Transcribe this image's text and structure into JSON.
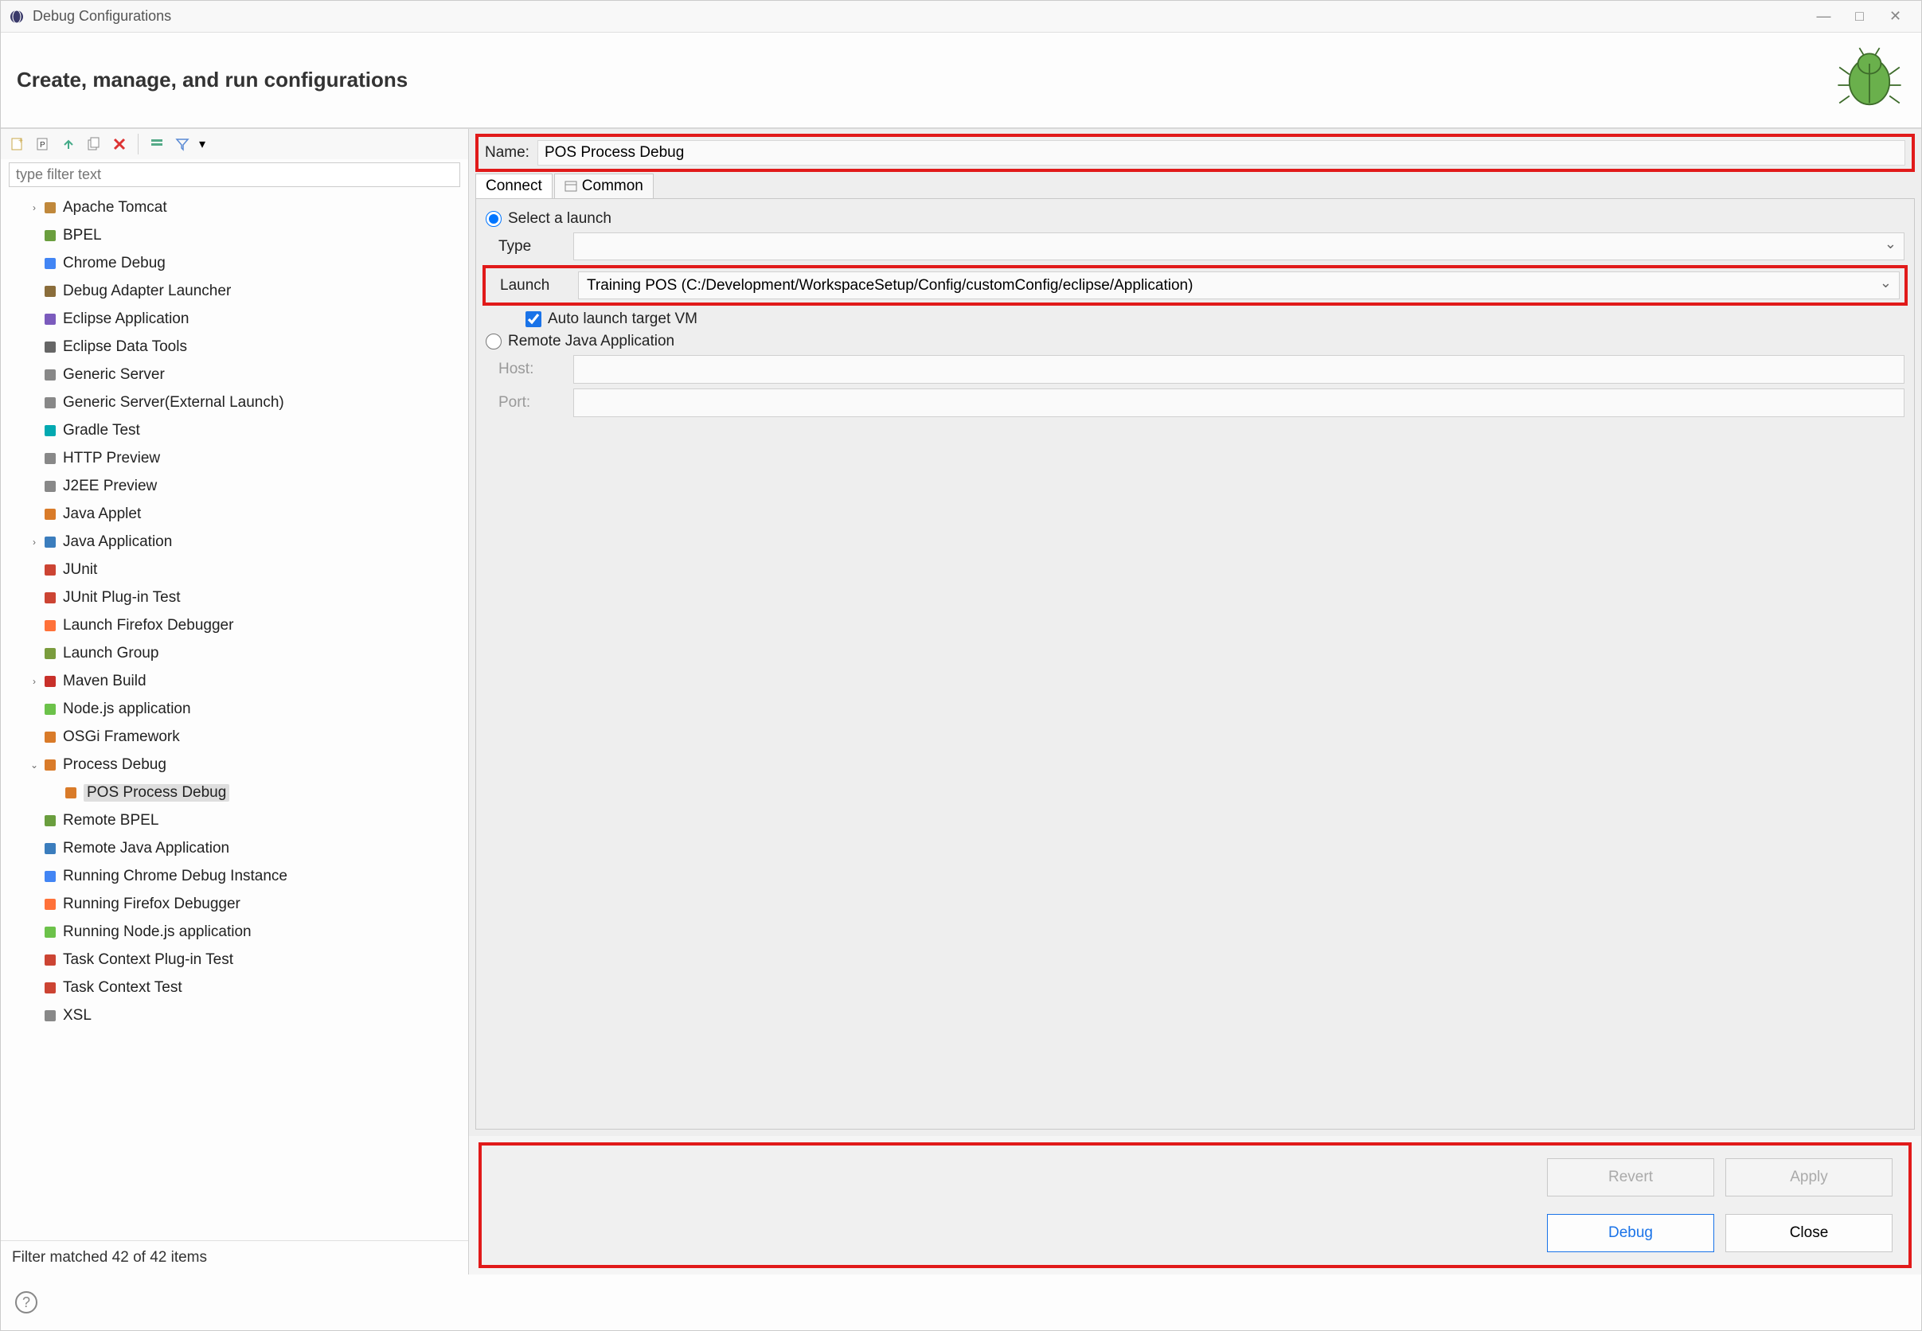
{
  "window": {
    "title": "Debug Configurations"
  },
  "header": {
    "title": "Create, manage, and run configurations"
  },
  "sidebar": {
    "filter_placeholder": "type filter text",
    "status": "Filter matched 42 of 42 items",
    "items": [
      {
        "label": "Apache Tomcat",
        "expandable": true
      },
      {
        "label": "BPEL"
      },
      {
        "label": "Chrome Debug"
      },
      {
        "label": "Debug Adapter Launcher"
      },
      {
        "label": "Eclipse Application"
      },
      {
        "label": "Eclipse Data Tools"
      },
      {
        "label": "Generic Server"
      },
      {
        "label": "Generic Server(External Launch)"
      },
      {
        "label": "Gradle Test"
      },
      {
        "label": "HTTP Preview"
      },
      {
        "label": "J2EE Preview"
      },
      {
        "label": "Java Applet"
      },
      {
        "label": "Java Application",
        "expandable": true
      },
      {
        "label": "JUnit"
      },
      {
        "label": "JUnit Plug-in Test"
      },
      {
        "label": "Launch Firefox Debugger"
      },
      {
        "label": "Launch Group"
      },
      {
        "label": "Maven Build",
        "expandable": true
      },
      {
        "label": "Node.js application"
      },
      {
        "label": "OSGi Framework"
      },
      {
        "label": "Process Debug",
        "expandable": true,
        "expanded": true,
        "children": [
          {
            "label": "POS Process Debug",
            "selected": true
          }
        ]
      },
      {
        "label": "Remote BPEL"
      },
      {
        "label": "Remote Java Application"
      },
      {
        "label": "Running Chrome Debug Instance"
      },
      {
        "label": "Running Firefox Debugger"
      },
      {
        "label": "Running Node.js application"
      },
      {
        "label": "Task Context Plug-in Test"
      },
      {
        "label": "Task Context Test"
      },
      {
        "label": "XSL"
      }
    ]
  },
  "details": {
    "name_label": "Name:",
    "name_value": "POS Process Debug",
    "tabs": [
      {
        "label": "Connect",
        "active": true
      },
      {
        "label": "Common"
      }
    ],
    "connect": {
      "radio_select_launch": "Select a launch",
      "type_label": "Type",
      "type_value": "",
      "launch_label": "Launch",
      "launch_value": "Training POS (C:/Development/WorkspaceSetup/Config/customConfig/eclipse/Application)",
      "auto_launch_label": "Auto launch target VM",
      "auto_launch_checked": true,
      "radio_remote": "Remote Java Application",
      "host_label": "Host:",
      "host_value": "",
      "port_label": "Port:",
      "port_value": ""
    }
  },
  "buttons": {
    "revert": "Revert",
    "apply": "Apply",
    "debug": "Debug",
    "close": "Close"
  }
}
